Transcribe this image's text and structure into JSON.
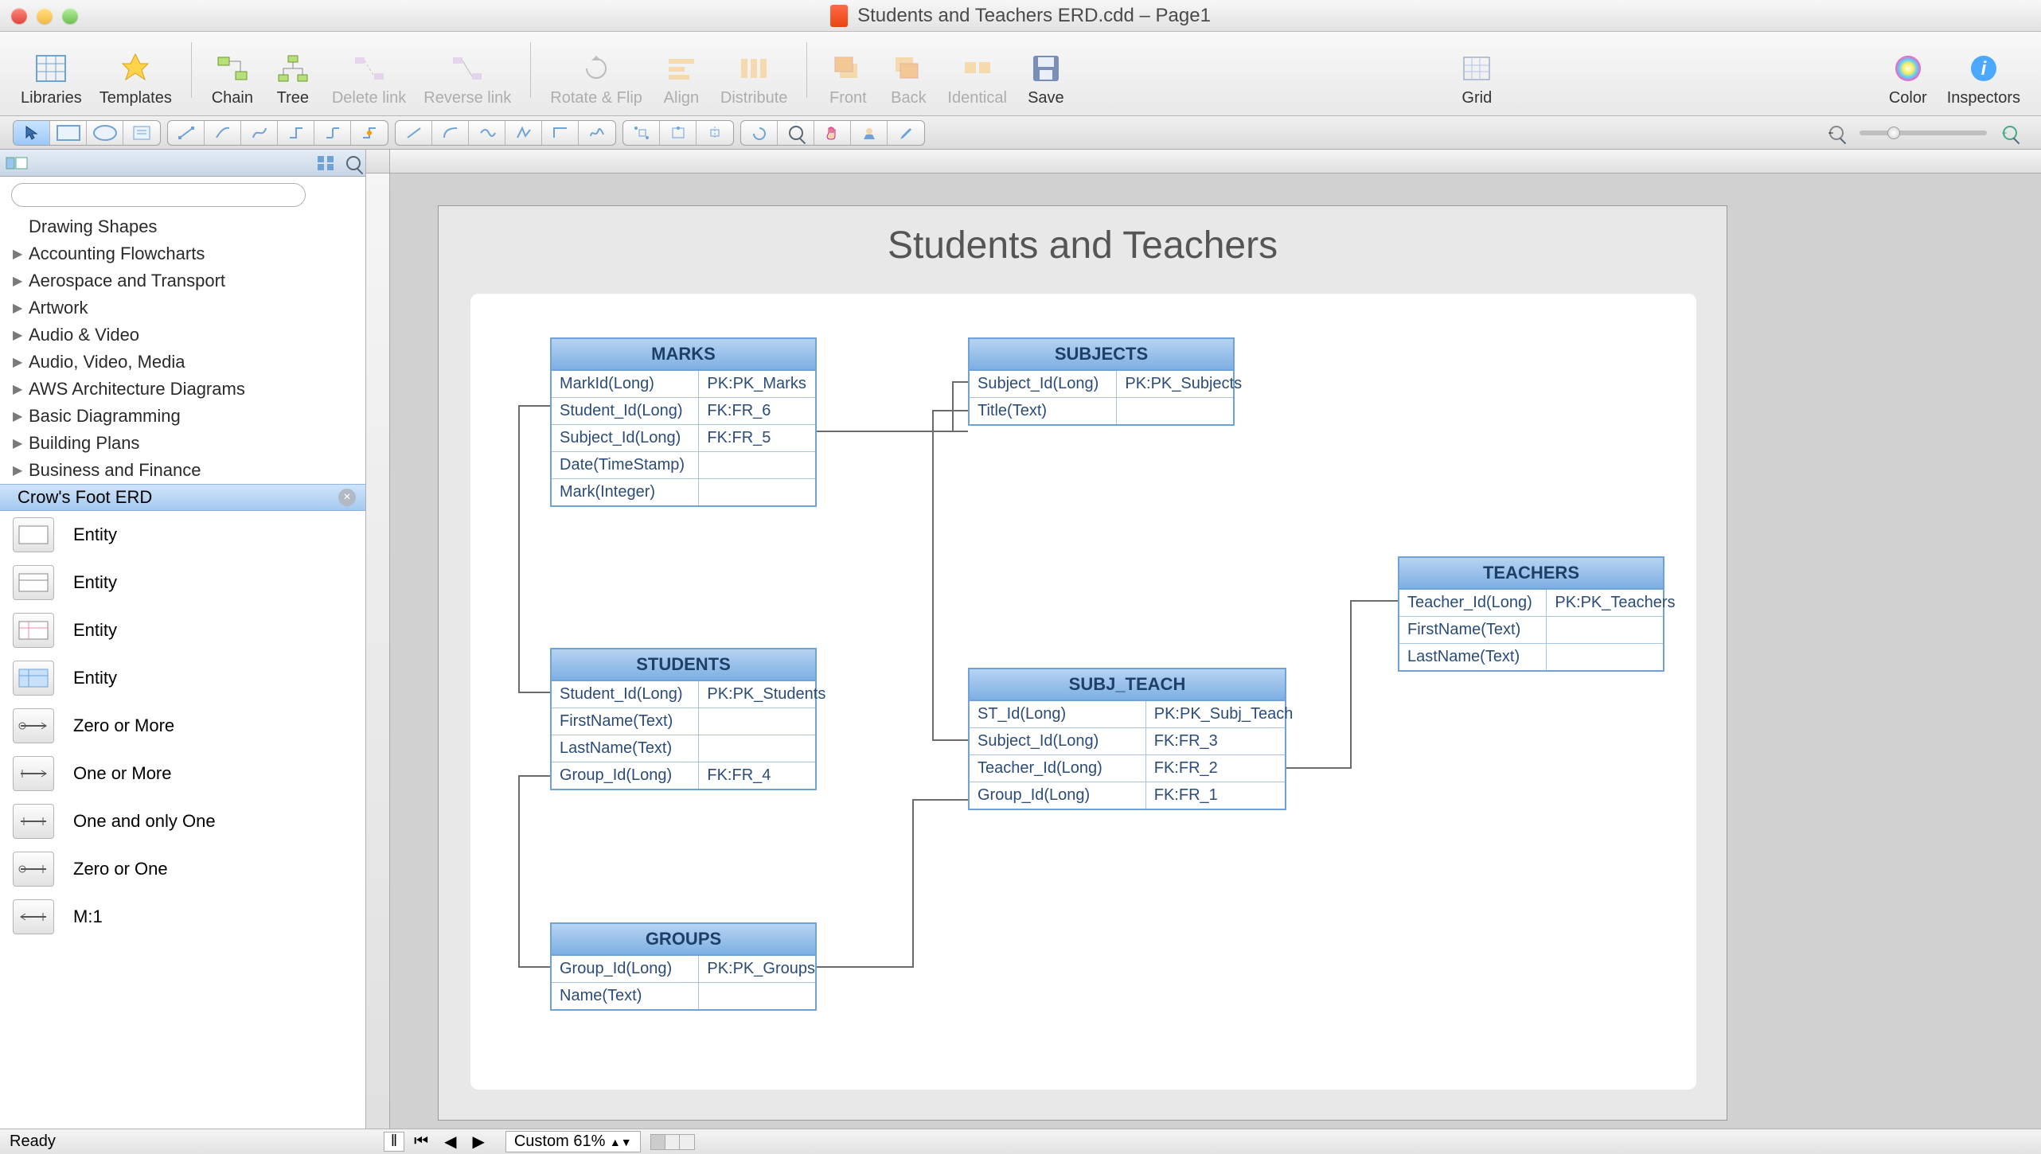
{
  "window": {
    "title": "Students and Teachers ERD.cdd – Page1"
  },
  "toolbar": {
    "libraries": "Libraries",
    "templates": "Templates",
    "chain": "Chain",
    "tree": "Tree",
    "delete_link": "Delete link",
    "reverse_link": "Reverse link",
    "rotate_flip": "Rotate & Flip",
    "align": "Align",
    "distribute": "Distribute",
    "front": "Front",
    "back": "Back",
    "identical": "Identical",
    "save": "Save",
    "grid": "Grid",
    "color": "Color",
    "inspectors": "Inspectors"
  },
  "sidebar": {
    "categories": [
      "Drawing Shapes",
      "Accounting Flowcharts",
      "Aerospace and Transport",
      "Artwork",
      "Audio & Video",
      "Audio, Video, Media",
      "AWS Architecture Diagrams",
      "Basic Diagramming",
      "Building Plans",
      "Business and Finance"
    ],
    "selected": "Crow's Foot ERD",
    "shapes": [
      {
        "label": "Entity"
      },
      {
        "label": "Entity"
      },
      {
        "label": "Entity"
      },
      {
        "label": "Entity"
      },
      {
        "label": "Zero or More"
      },
      {
        "label": "One or More"
      },
      {
        "label": "One and only One"
      },
      {
        "label": "Zero or One"
      },
      {
        "label": "M:1"
      }
    ]
  },
  "diagram": {
    "title": "Students and Teachers",
    "entities": {
      "marks": {
        "name": "MARKS",
        "rows": [
          [
            "MarkId(Long)",
            "PK:PK_Marks"
          ],
          [
            "Student_Id(Long)",
            "FK:FR_6"
          ],
          [
            "Subject_Id(Long)",
            "FK:FR_5"
          ],
          [
            "Date(TimeStamp)",
            ""
          ],
          [
            "Mark(Integer)",
            ""
          ]
        ]
      },
      "subjects": {
        "name": "SUBJECTS",
        "rows": [
          [
            "Subject_Id(Long)",
            "PK:PK_Subjects"
          ],
          [
            "Title(Text)",
            ""
          ]
        ]
      },
      "students": {
        "name": "STUDENTS",
        "rows": [
          [
            "Student_Id(Long)",
            "PK:PK_Students"
          ],
          [
            "FirstName(Text)",
            ""
          ],
          [
            "LastName(Text)",
            ""
          ],
          [
            "Group_Id(Long)",
            "FK:FR_4"
          ]
        ]
      },
      "subj_teach": {
        "name": "SUBJ_TEACH",
        "rows": [
          [
            "ST_Id(Long)",
            "PK:PK_Subj_Teach"
          ],
          [
            "Subject_Id(Long)",
            "FK:FR_3"
          ],
          [
            "Teacher_Id(Long)",
            "FK:FR_2"
          ],
          [
            "Group_Id(Long)",
            "FK:FR_1"
          ]
        ]
      },
      "teachers": {
        "name": "TEACHERS",
        "rows": [
          [
            "Teacher_Id(Long)",
            "PK:PK_Teachers"
          ],
          [
            "FirstName(Text)",
            ""
          ],
          [
            "LastName(Text)",
            ""
          ]
        ]
      },
      "groups": {
        "name": "GROUPS",
        "rows": [
          [
            "Group_Id(Long)",
            "PK:PK_Groups"
          ],
          [
            "Name(Text)",
            ""
          ]
        ]
      }
    }
  },
  "footer": {
    "status": "Ready",
    "zoom": "Custom 61%"
  }
}
